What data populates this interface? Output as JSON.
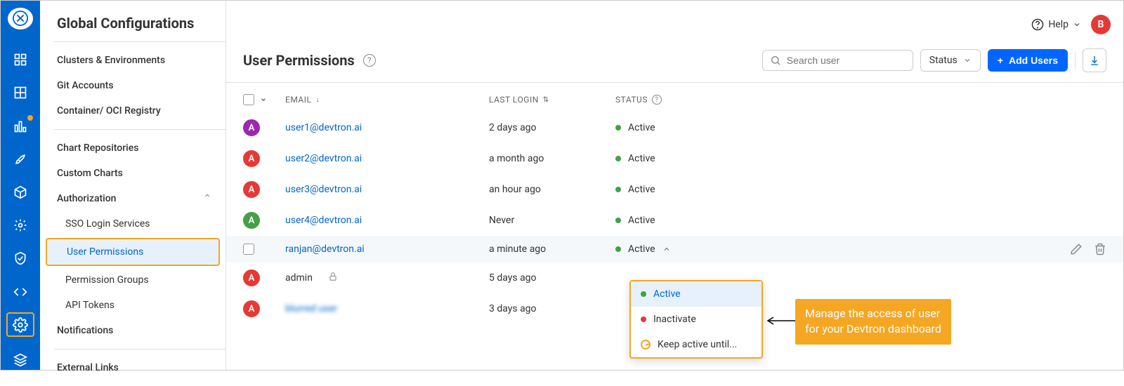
{
  "header": {
    "title": "Global Configurations",
    "help_label": "Help",
    "avatar_initial": "B"
  },
  "sidebar": {
    "items": [
      {
        "label": "Clusters & Environments"
      },
      {
        "label": "Git Accounts"
      },
      {
        "label": "Container/ OCI Registry"
      },
      {
        "label": "Chart Repositories"
      },
      {
        "label": "Custom Charts"
      },
      {
        "label": "Authorization",
        "expanded": true,
        "children": [
          {
            "label": "SSO Login Services"
          },
          {
            "label": "User Permissions",
            "active": true
          },
          {
            "label": "Permission Groups"
          },
          {
            "label": "API Tokens"
          }
        ]
      },
      {
        "label": "Notifications"
      },
      {
        "label": "External Links"
      }
    ]
  },
  "toolbar": {
    "page_title": "User Permissions",
    "search_placeholder": "Search user",
    "status_filter_label": "Status",
    "add_button_label": "Add Users"
  },
  "columns": {
    "email": "EMAIL",
    "last_login": "LAST LOGIN",
    "status": "STATUS"
  },
  "rows": [
    {
      "initial": "A",
      "av_color": "av-purple",
      "email": "user1@devtron.ai",
      "last_login": "2 days ago",
      "status": "Active",
      "status_color": "green"
    },
    {
      "initial": "A",
      "av_color": "av-red",
      "email": "user2@devtron.ai",
      "last_login": "a month ago",
      "status": "Active",
      "status_color": "green"
    },
    {
      "initial": "A",
      "av_color": "av-red",
      "email": "user3@devtron.ai",
      "last_login": "an hour ago",
      "status": "Active",
      "status_color": "green"
    },
    {
      "initial": "A",
      "av_color": "av-green",
      "email": "user4@devtron.ai",
      "last_login": "Never",
      "status": "Active",
      "status_color": "green"
    },
    {
      "initial": "",
      "av_color": "",
      "email": "ranjan@devtron.ai",
      "last_login": "a minute ago",
      "status": "Active",
      "status_color": "green",
      "hovered": true,
      "show_cb": true,
      "show_actions": true,
      "status_open": true
    },
    {
      "initial": "A",
      "av_color": "av-red",
      "email": "admin",
      "last_login": "5 days ago",
      "status": "",
      "locked": true,
      "plain_email": true
    },
    {
      "initial": "A",
      "av_color": "av-red",
      "email": "blurred user",
      "last_login": "3 days ago",
      "status": "",
      "blurred": true
    }
  ],
  "dropdown": {
    "items": [
      {
        "label": "Active",
        "icon": "green-dot",
        "active": true
      },
      {
        "label": "Inactivate",
        "icon": "red-dot"
      },
      {
        "label": "Keep active until...",
        "icon": "clock"
      }
    ]
  },
  "annotation": {
    "line1": "Manage the access of user",
    "line2": "for your Devtron dashboard"
  }
}
